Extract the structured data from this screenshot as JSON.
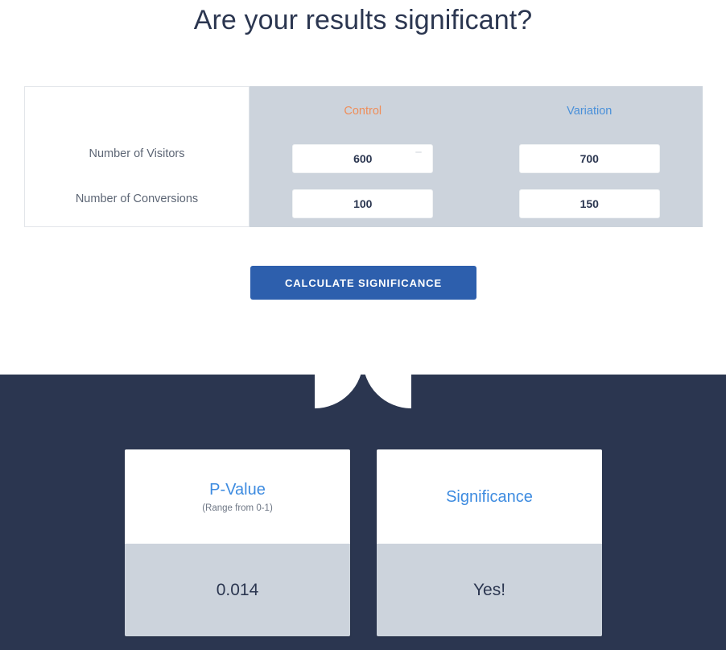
{
  "page": {
    "title": "Are your results significant?"
  },
  "calculator": {
    "columns": [
      {
        "key": "control",
        "label": "Control",
        "color": "#ef8e5a"
      },
      {
        "key": "variation",
        "label": "Variation",
        "color": "#4a90d9"
      }
    ],
    "rows": [
      {
        "label": "Number of Visitors",
        "control": "600",
        "variation": "700",
        "placeholder": ""
      },
      {
        "label": "Number of Conversions",
        "control": "100",
        "variation": "150",
        "placeholder": ""
      }
    ],
    "submit_label": "CALCULATE SIGNIFICANCE",
    "table_background": "#ccd3dc"
  },
  "results": {
    "panel_background": "#2b3650",
    "cards": [
      {
        "title": "P-Value",
        "subtitle": "(Range from 0-1)",
        "value": "0.014",
        "title_color": "#3d8be0"
      },
      {
        "title": "Significance",
        "subtitle": "",
        "value": "Yes!",
        "title_color": "#3d8be0"
      }
    ]
  }
}
